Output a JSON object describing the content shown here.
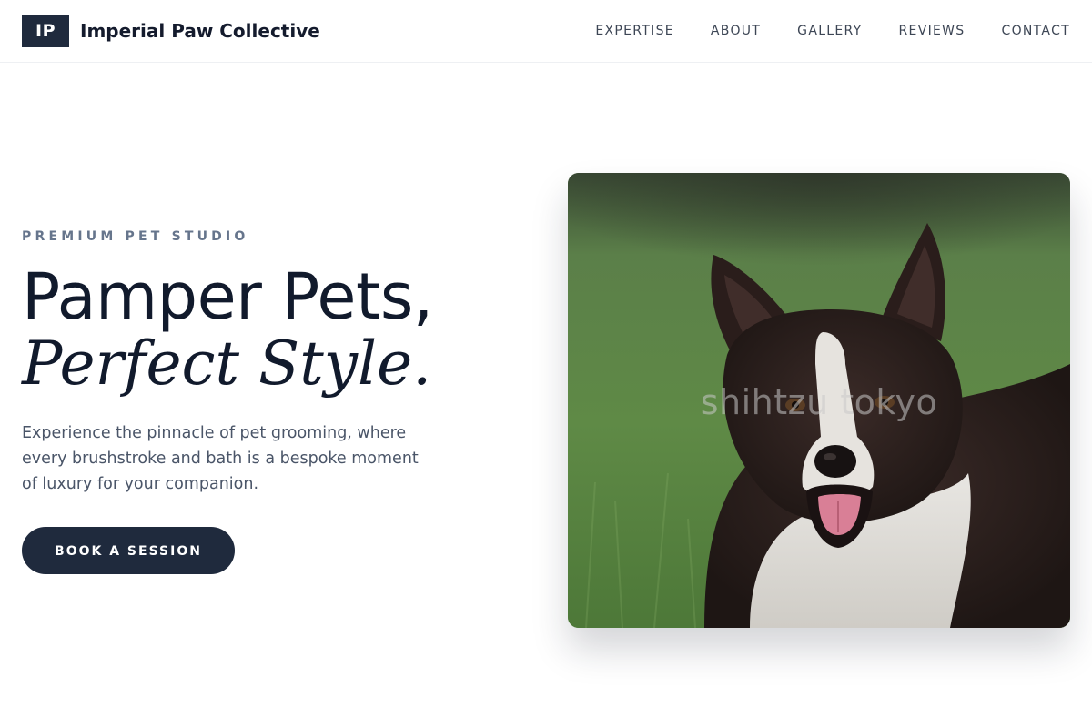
{
  "brand": {
    "logo_initials": "IP",
    "name": "Imperial Paw Collective"
  },
  "nav": {
    "items": [
      "EXPERTISE",
      "ABOUT",
      "GALLERY",
      "REVIEWS",
      "CONTACT"
    ]
  },
  "hero": {
    "eyebrow": "PREMIUM PET STUDIO",
    "headline_line1": "Pamper Pets,",
    "headline_line2": "Perfect Style.",
    "description": "Experience the pinnacle of pet grooming, where every brushstroke and bath is a bespoke moment of luxury for your companion.",
    "cta_label": "BOOK A SESSION",
    "image_watermark": "shihtzu tokyo"
  },
  "colors": {
    "primary": "#1f2a3d",
    "eyebrow": "#66758c",
    "body_text": "#4a5568"
  }
}
